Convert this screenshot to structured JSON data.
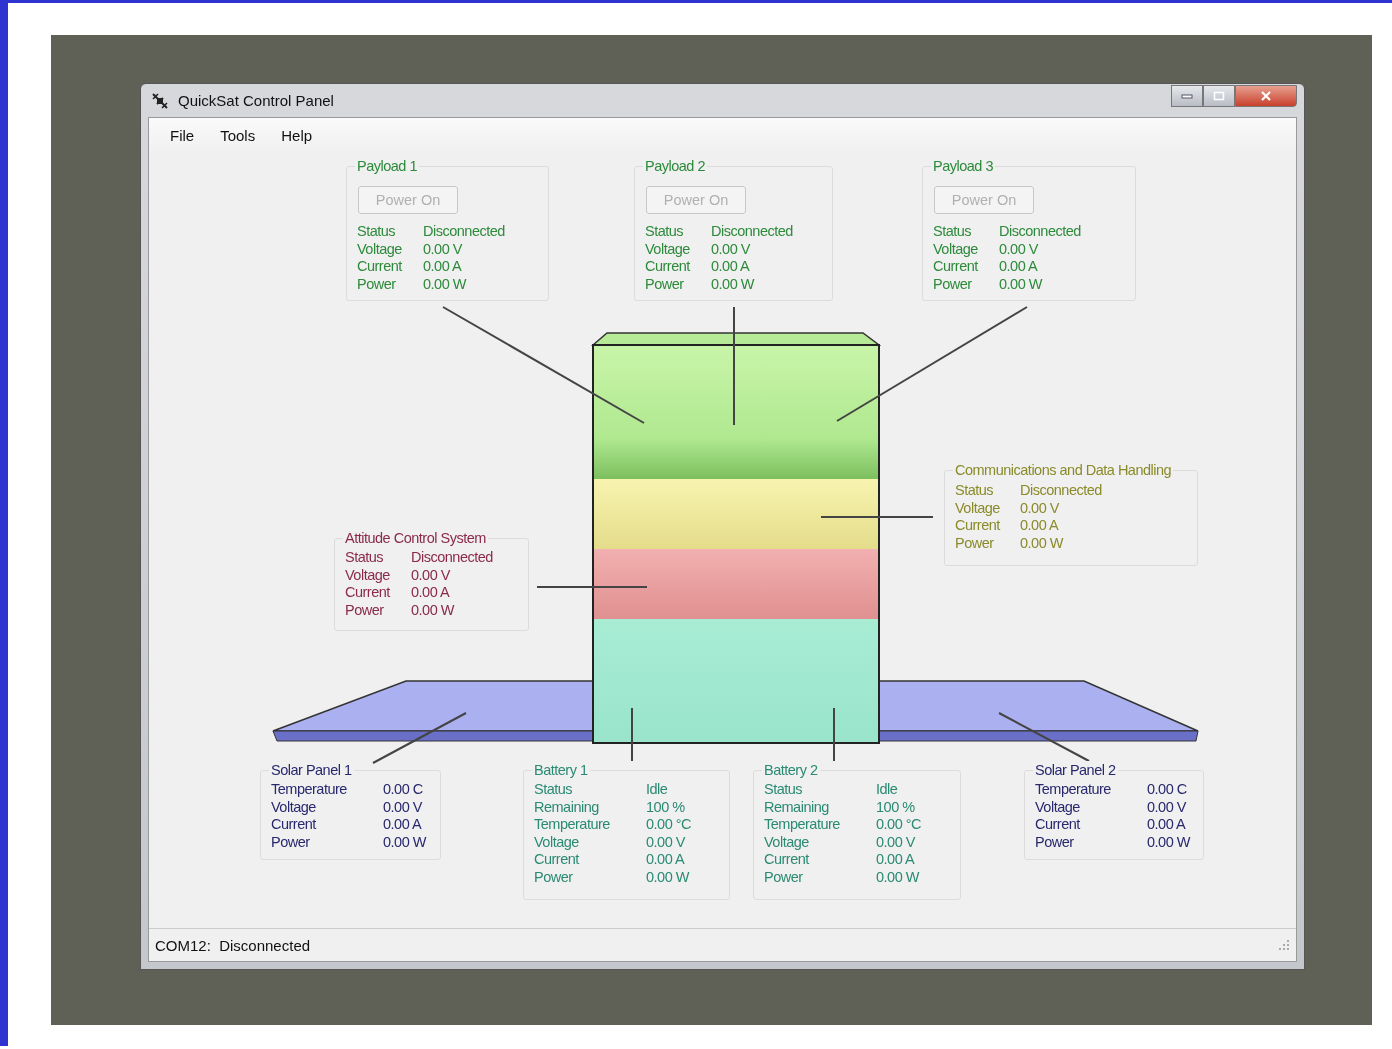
{
  "window": {
    "title": "QuickSat Control Panel"
  },
  "menu": [
    {
      "label": "File"
    },
    {
      "label": "Tools"
    },
    {
      "label": "Help"
    }
  ],
  "modules": [
    {
      "kind": "payload",
      "title": "Payload 1",
      "button": {
        "label": "Power On",
        "disabled": true
      },
      "rows": [
        {
          "label": "Status",
          "value": "Disconnected"
        },
        {
          "label": "Voltage",
          "value": "0.00 V"
        },
        {
          "label": "Current",
          "value": "0.00 A"
        },
        {
          "label": "Power",
          "value": "0.00 W"
        }
      ]
    },
    {
      "kind": "payload",
      "title": "Payload 2",
      "button": {
        "label": "Power On",
        "disabled": true
      },
      "rows": [
        {
          "label": "Status",
          "value": "Disconnected"
        },
        {
          "label": "Voltage",
          "value": "0.00 V"
        },
        {
          "label": "Current",
          "value": "0.00 A"
        },
        {
          "label": "Power",
          "value": "0.00 W"
        }
      ]
    },
    {
      "kind": "payload",
      "title": "Payload 3",
      "button": {
        "label": "Power On",
        "disabled": true
      },
      "rows": [
        {
          "label": "Status",
          "value": "Disconnected"
        },
        {
          "label": "Voltage",
          "value": "0.00 V"
        },
        {
          "label": "Current",
          "value": "0.00 A"
        },
        {
          "label": "Power",
          "value": "0.00 W"
        }
      ]
    },
    {
      "kind": "comms",
      "title": "Communications and Data Handling",
      "rows": [
        {
          "label": "Status",
          "value": "Disconnected"
        },
        {
          "label": "Voltage",
          "value": "0.00 V"
        },
        {
          "label": "Current",
          "value": "0.00 A"
        },
        {
          "label": "Power",
          "value": "0.00 W"
        }
      ]
    },
    {
      "kind": "attitude",
      "title": "Attitude Control System",
      "rows": [
        {
          "label": "Status",
          "value": "Disconnected"
        },
        {
          "label": "Voltage",
          "value": "0.00 V"
        },
        {
          "label": "Current",
          "value": "0.00 A"
        },
        {
          "label": "Power",
          "value": "0.00 W"
        }
      ]
    },
    {
      "kind": "solar",
      "title": "Solar Panel 1",
      "rows": [
        {
          "label": "Temperature",
          "value": "0.00 C"
        },
        {
          "label": "Voltage",
          "value": "0.00 V"
        },
        {
          "label": "Current",
          "value": "0.00 A"
        },
        {
          "label": "Power",
          "value": "0.00 W"
        }
      ]
    },
    {
      "kind": "battery",
      "title": "Battery 1",
      "rows": [
        {
          "label": "Status",
          "value": "Idle"
        },
        {
          "label": "Remaining",
          "value": "100 %"
        },
        {
          "label": "Temperature",
          "value": "0.00 °C"
        },
        {
          "label": "Voltage",
          "value": "0.00 V"
        },
        {
          "label": "Current",
          "value": "0.00 A"
        },
        {
          "label": "Power",
          "value": "0.00 W"
        }
      ]
    },
    {
      "kind": "battery",
      "title": "Battery 2",
      "rows": [
        {
          "label": "Status",
          "value": "Idle"
        },
        {
          "label": "Remaining",
          "value": "100 %"
        },
        {
          "label": "Temperature",
          "value": "0.00 °C"
        },
        {
          "label": "Voltage",
          "value": "0.00 V"
        },
        {
          "label": "Current",
          "value": "0.00 A"
        },
        {
          "label": "Power",
          "value": "0.00 W"
        }
      ]
    },
    {
      "kind": "solar",
      "title": "Solar Panel 2",
      "rows": [
        {
          "label": "Temperature",
          "value": "0.00 C"
        },
        {
          "label": "Voltage",
          "value": "0.00 V"
        },
        {
          "label": "Current",
          "value": "0.00 A"
        },
        {
          "label": "Power",
          "value": "0.00 W"
        }
      ]
    }
  ],
  "status_bar": {
    "text": "COM12:  Disconnected"
  }
}
